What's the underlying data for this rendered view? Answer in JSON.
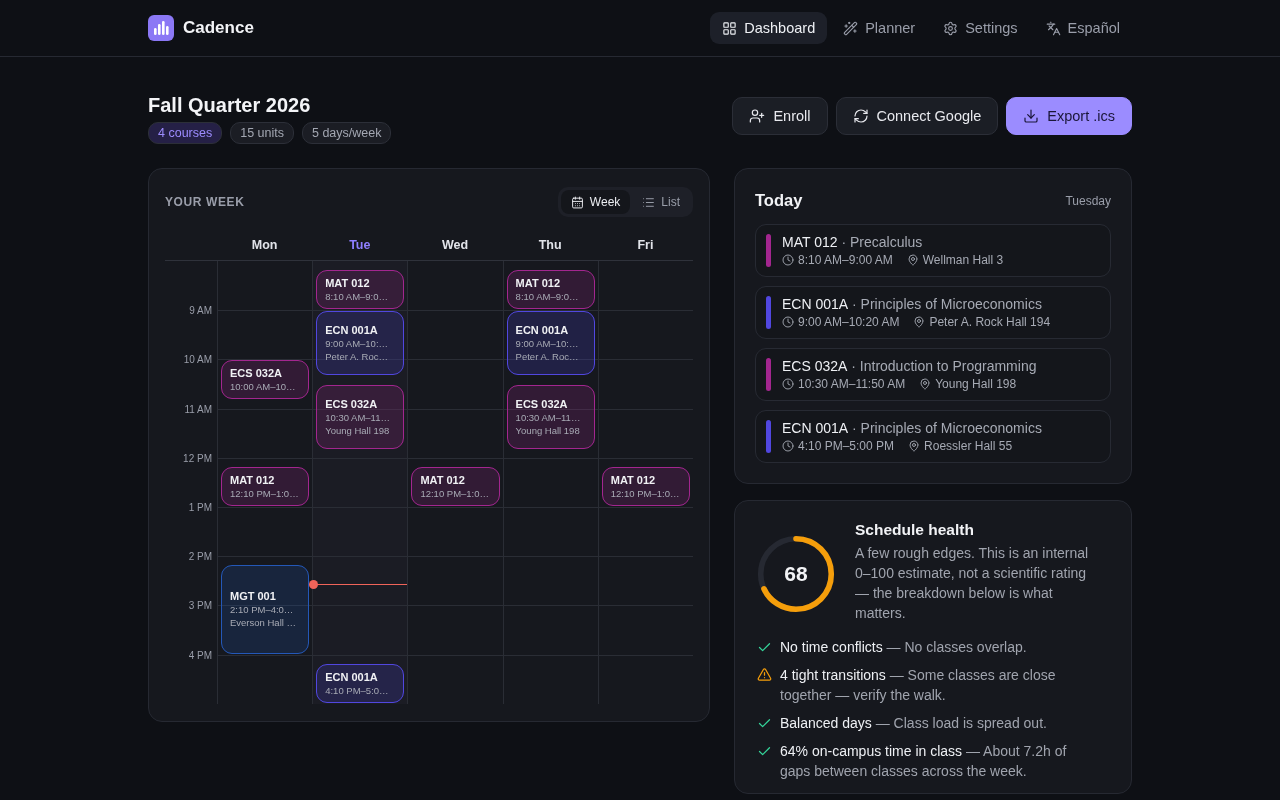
{
  "app": {
    "name": "Cadence"
  },
  "nav": [
    {
      "label": "Dashboard",
      "selected": true
    },
    {
      "label": "Planner",
      "selected": false
    },
    {
      "label": "Settings",
      "selected": false
    },
    {
      "label": "Español",
      "selected": false
    }
  ],
  "term": {
    "title": "Fall Quarter 2026",
    "badges": [
      {
        "label": "4 courses",
        "accent": true
      },
      {
        "label": "15 units",
        "accent": false
      },
      {
        "label": "5 days/week",
        "accent": false
      }
    ]
  },
  "actions": [
    {
      "label": "Enroll",
      "primary": false
    },
    {
      "label": "Connect Google",
      "primary": false
    },
    {
      "label": "Export .ics",
      "primary": true
    }
  ],
  "week": {
    "title": "YOUR WEEK",
    "views": [
      {
        "label": "Week",
        "selected": true
      },
      {
        "label": "List",
        "selected": false
      }
    ],
    "days": [
      {
        "label": "Mon",
        "today": false,
        "events": [
          {
            "code": "ECS 032A",
            "time": "10:00 AM–10…",
            "kind": "short",
            "color": "#a3268f"
          },
          {
            "code": "MAT 012",
            "time": "12:10 PM–1:0…",
            "kind": "short",
            "color": "#a3268f"
          },
          {
            "code": "MGT 001",
            "time": "2:10 PM–4:0…",
            "place": "Everson Hall …",
            "kind": "long",
            "color": "#2458b8"
          }
        ]
      },
      {
        "label": "Tue",
        "today": true,
        "now_line": true,
        "events": [
          {
            "code": "MAT 012",
            "time": "8:10 AM–9:0…",
            "kind": "short",
            "color": "#a3268f"
          },
          {
            "code": "ECN 001A",
            "time": "9:00 AM–10:…",
            "place": "Peter A. Roc…",
            "kind": "medium",
            "color": "#5147e0"
          },
          {
            "code": "ECS 032A",
            "time": "10:30 AM–11…",
            "place": "Young Hall 198",
            "kind": "medium",
            "color": "#a3268f"
          },
          {
            "code": "ECN 001A",
            "time": "4:10 PM–5:0…",
            "kind": "short",
            "color": "#5147e0"
          }
        ]
      },
      {
        "label": "Wed",
        "today": false,
        "events": [
          {
            "code": "MAT 012",
            "time": "12:10 PM–1:0…",
            "kind": "short",
            "color": "#a3268f"
          }
        ]
      },
      {
        "label": "Thu",
        "today": false,
        "events": [
          {
            "code": "MAT 012",
            "time": "8:10 AM–9:0…",
            "kind": "short",
            "color": "#a3268f"
          },
          {
            "code": "ECN 001A",
            "time": "9:00 AM–10:…",
            "place": "Peter A. Roc…",
            "kind": "medium",
            "color": "#5147e0"
          },
          {
            "code": "ECS 032A",
            "time": "10:30 AM–11…",
            "place": "Young Hall 198",
            "kind": "medium",
            "color": "#a3268f"
          }
        ]
      },
      {
        "label": "Fri",
        "today": false,
        "events": [
          {
            "code": "MAT 012",
            "time": "12:10 PM–1:0…",
            "kind": "short",
            "color": "#a3268f"
          }
        ]
      }
    ],
    "hours": [
      "9 AM",
      "10 AM",
      "11 AM",
      "12 PM",
      "1 PM",
      "2 PM",
      "3 PM",
      "4 PM"
    ]
  },
  "today": {
    "title": "Today",
    "day": "Tuesday",
    "items": [
      {
        "course": "**MAT 012** · Precalculus",
        "time": "8:10 AM–9:00 AM",
        "place": "Wellman Hall 3",
        "color": "#a3268f"
      },
      {
        "course": "**ECN 001A** · Principles of Microeconomics",
        "time": "9:00 AM–10:20 AM",
        "place": "Peter A. Rock Hall 194",
        "color": "#5147e0"
      },
      {
        "course": "**ECS 032A** · Introduction to Programming",
        "time": "10:30 AM–11:50 AM",
        "place": "Young Hall 198",
        "color": "#a3268f"
      },
      {
        "course": "**ECN 001A** · Principles of Microeconomics",
        "time": "4:10 PM–5:00 PM",
        "place": "Roessler Hall 55",
        "color": "#5147e0"
      }
    ]
  },
  "health": {
    "score": "68",
    "level": 0.68,
    "title": "Schedule health",
    "summary": "A few rough edges. This is an internal 0–100 estimate, not a scientific rating — the breakdown below is what matters.",
    "checks": [
      {
        "kind": "ok",
        "text": "**No time conflicts** — No classes overlap."
      },
      {
        "kind": "warning",
        "text": "**4 tight transitions** — Some classes are close together — verify the walk."
      },
      {
        "kind": "ok",
        "text": "**Balanced days** — Class load is spread out."
      },
      {
        "kind": "ok",
        "text": "**64% on-campus time in class** — About 7.2h of gaps between classes across the week."
      }
    ]
  }
}
